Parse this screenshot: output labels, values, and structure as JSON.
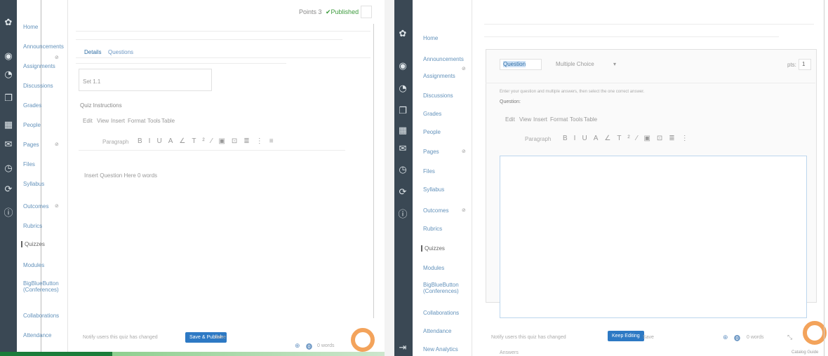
{
  "left": {
    "global_nav": [
      "gear-icon",
      "account-icon",
      "dashboard-icon",
      "courses-icon",
      "calendar-icon",
      "inbox-icon",
      "history-icon",
      "commons-icon",
      "help-icon"
    ],
    "course_nav": {
      "items": [
        {
          "label": "Home"
        },
        {
          "label": "Announcements",
          "hidden": true
        },
        {
          "label": "Assignments"
        },
        {
          "label": "Discussions"
        },
        {
          "label": "Grades"
        },
        {
          "label": "People"
        },
        {
          "label": "Pages",
          "hidden": true
        },
        {
          "label": "Files"
        },
        {
          "label": "Syllabus"
        },
        {
          "label": "Outcomes",
          "hidden": true
        },
        {
          "label": "Rubrics"
        },
        {
          "label": "Quizzes",
          "active": true
        },
        {
          "label": "Modules"
        },
        {
          "label": "BigBlueButton (Conferences)"
        },
        {
          "label": "Collaborations"
        },
        {
          "label": "Attendance"
        }
      ]
    },
    "header": {
      "points": "Points 3",
      "published": "Published"
    },
    "tabs": {
      "details": "Details",
      "questions": "Questions"
    },
    "editor": {
      "menu": [
        "Edit",
        "View",
        "Insert",
        "Format",
        "Tools",
        "Table"
      ],
      "paragraph": "Paragraph",
      "label": "Quiz Instructions",
      "small_value": "Set 1.1",
      "word_count": "Insert Question Here  0 words"
    },
    "footer": {
      "notify_text": "Notify users this quiz has changed",
      "save_label": "Save & Publish",
      "cancel_label": "Save",
      "keyboard": "0 words"
    }
  },
  "right": {
    "global_nav": [
      "gear-icon",
      "account-icon",
      "dashboard-icon",
      "courses-icon",
      "calendar-icon",
      "inbox-icon",
      "history-icon",
      "commons-icon",
      "help-icon",
      "collapse-icon"
    ],
    "course_nav": {
      "items": [
        {
          "label": "Home"
        },
        {
          "label": "Announcements",
          "hidden": true
        },
        {
          "label": "Assignments"
        },
        {
          "label": "Discussions"
        },
        {
          "label": "Grades"
        },
        {
          "label": "People"
        },
        {
          "label": "Pages",
          "hidden": true
        },
        {
          "label": "Files"
        },
        {
          "label": "Syllabus"
        },
        {
          "label": "Outcomes",
          "hidden": true
        },
        {
          "label": "Rubrics"
        },
        {
          "label": "Quizzes",
          "active": true
        },
        {
          "label": "Modules"
        },
        {
          "label": "BigBlueButton (Conferences)"
        },
        {
          "label": "Collaborations"
        },
        {
          "label": "Attendance"
        },
        {
          "label": "New Analytics"
        }
      ]
    },
    "question": {
      "name": "Question",
      "type": "Multiple Choice",
      "pts_label": "pts:",
      "pts_value": "1",
      "hint": "Enter your question and multiple answers, then select the one correct answer.",
      "label": "Question:"
    },
    "editor": {
      "menu": [
        "Edit",
        "View",
        "Insert",
        "Format",
        "Tools",
        "Table"
      ],
      "paragraph": "Paragraph"
    },
    "footer": {
      "notify_text": "Notify users this quiz has changed",
      "save_label": "Keep Editing",
      "cancel_label": "Save",
      "keyboard": "0 words",
      "bottom_label": "Answers",
      "corner": "Catalog Guide"
    }
  }
}
